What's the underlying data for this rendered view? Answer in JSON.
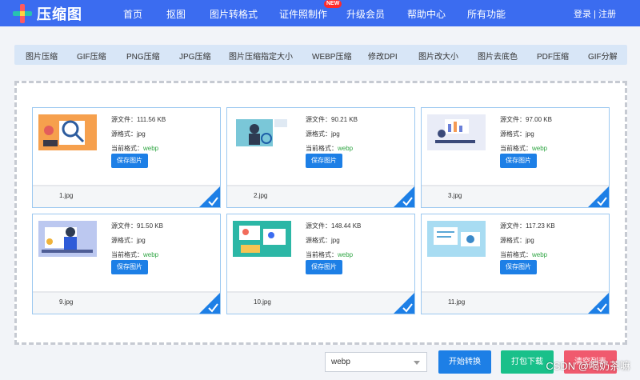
{
  "header": {
    "logo_text": "压缩图",
    "nav": [
      "首页",
      "抠图",
      "图片转格式",
      "证件照制作",
      "升级会员",
      "帮助中心",
      "所有功能"
    ],
    "new_badge": "NEW",
    "login": "登录",
    "separator": "|",
    "register": "注册"
  },
  "tools": [
    "图片压缩",
    "GIF压缩",
    "PNG压缩",
    "JPG压缩",
    "图片压缩指定大小",
    "WEBP压缩",
    "修改DPI",
    "图片改大小",
    "图片去底色",
    "PDF压缩",
    "GIF分解"
  ],
  "cards": [
    {
      "source_size": "源文件：111.56 KB",
      "source_format": "源格式：jpg",
      "current_label": "当前格式：",
      "current_format": "webp",
      "save_label": "保存图片",
      "filename": "1.jpg"
    },
    {
      "source_size": "源文件：90.21 KB",
      "source_format": "源格式：jpg",
      "current_label": "当前格式：",
      "current_format": "webp",
      "save_label": "保存图片",
      "filename": "2.jpg"
    },
    {
      "source_size": "源文件：97.00 KB",
      "source_format": "源格式：jpg",
      "current_label": "当前格式：",
      "current_format": "webp",
      "save_label": "保存图片",
      "filename": "3.jpg"
    },
    {
      "source_size": "源文件：91.50 KB",
      "source_format": "源格式：jpg",
      "current_label": "当前格式：",
      "current_format": "webp",
      "save_label": "保存图片",
      "filename": "9.jpg"
    },
    {
      "source_size": "源文件：148.44 KB",
      "source_format": "源格式：jpg",
      "current_label": "当前格式：",
      "current_format": "webp",
      "save_label": "保存图片",
      "filename": "10.jpg"
    },
    {
      "source_size": "源文件：117.23 KB",
      "source_format": "源格式：jpg",
      "current_label": "当前格式：",
      "current_format": "webp",
      "save_label": "保存图片",
      "filename": "11.jpg"
    }
  ],
  "controls": {
    "format_value": "webp",
    "start_label": "开始转换",
    "pack_label": "打包下载",
    "clear_label": "清空列表"
  },
  "watermark": "CSDN @喝奶茶嘛",
  "colors": {
    "header": "#3b6cf0",
    "primary": "#1d7fe6",
    "success": "#19c08a",
    "danger": "#f05a6e",
    "format_green": "#2fa543"
  }
}
